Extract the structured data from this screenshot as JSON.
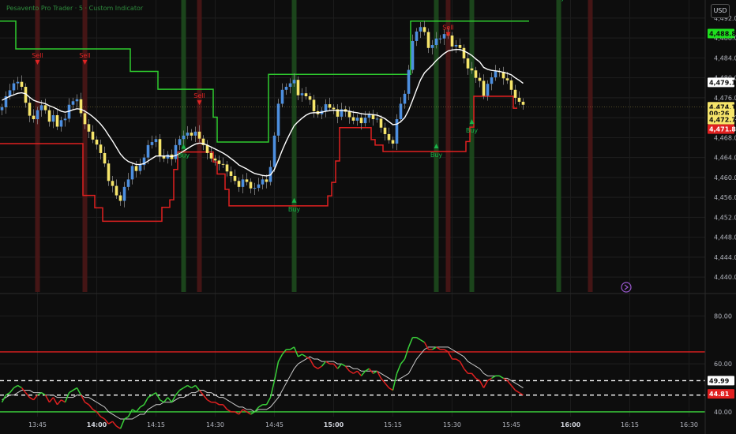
{
  "header": {
    "title": "Pesavento Pro Trader · 5 · Custom Indicator",
    "currency": "USD"
  },
  "colors": {
    "background": "#0d0d0d",
    "bull_candle": "#4d8fe0",
    "bear_candle": "#f6e56a",
    "upper_band": "#2ecc2e",
    "lower_band": "#e02020",
    "basis": "#ffffff",
    "buy_signal": "#19b34a",
    "sell_signal": "#e02424",
    "buy_highlight": "#1d4a1d",
    "sell_highlight": "#4a1616",
    "osc_bull": "#3ad13a",
    "osc_bear": "#e02020",
    "osc_signal": "#cccccc"
  },
  "chart_data": [
    {
      "type": "candlestick",
      "ylim": [
        4437,
        4495
      ],
      "y_ticks": [
        "4,492.00",
        "4,488.00",
        "4,484.00",
        "4,480.00",
        "4,476.00",
        "4,472.00",
        "4,468.00",
        "4,464.00",
        "4,460.00",
        "4,456.00",
        "4,452.00",
        "4,448.00",
        "4,444.00",
        "4,440.00"
      ],
      "y_tick_values": [
        4492,
        4488,
        4484,
        4480,
        4476,
        4472,
        4468,
        4464,
        4460,
        4456,
        4452,
        4448,
        4444,
        4440
      ],
      "x_ticks": [
        "13:45",
        "14:00",
        "14:15",
        "14:30",
        "14:45",
        "15:00",
        "15:15",
        "15:30",
        "15:45",
        "16:00",
        "16:15",
        "16:30"
      ],
      "x_ticks_bold": [
        "14:00",
        "15:00",
        "16:00"
      ],
      "start_time": "13:36",
      "bar_minutes": 1,
      "close": [
        4474.1,
        4476.3,
        4477.5,
        4478.9,
        4479.2,
        4478.2,
        4475.0,
        4472.4,
        4471.7,
        4473.5,
        4474.5,
        4473.5,
        4471.2,
        4472.5,
        4470.2,
        4471.5,
        4471.8,
        4474.6,
        4475.3,
        4475.7,
        4472.9,
        4470.7,
        4469.2,
        4467.6,
        4466.6,
        4464.9,
        4462.8,
        4459.3,
        4458.3,
        4456.4,
        4455.3,
        4458.1,
        4459.6,
        4462.3,
        4461.3,
        4462.5,
        4464.0,
        4466.5,
        4467.1,
        4467.7,
        4464.4,
        4463.8,
        4464.6,
        4463.7,
        4466.5,
        4467.7,
        4468.4,
        4469.0,
        4468.4,
        4469.2,
        4467.8,
        4466.5,
        4464.9,
        4463.8,
        4463.4,
        4462.7,
        4462.6,
        4461.2,
        4460.3,
        4459.3,
        4458.1,
        4459.6,
        4459.1,
        4457.8,
        4457.9,
        4458.6,
        4459.6,
        4459.1,
        4462.1,
        4468.4,
        4474.8,
        4477.6,
        4478.2,
        4478.9,
        4479.6,
        4476.5,
        4476.9,
        4476.3,
        4475.6,
        4473.3,
        4472.7,
        4473.4,
        4474.7,
        4474.0,
        4473.7,
        4472.2,
        4473.7,
        4473.2,
        4472.1,
        4471.4,
        4472.0,
        4470.9,
        4472.0,
        4472.6,
        4471.7,
        4471.8,
        4470.0,
        4468.7,
        4467.5,
        4466.8,
        4471.7,
        4474.8,
        4476.8,
        4481.6,
        4487.4,
        4489.3,
        4490.2,
        4489.2,
        4486.0,
        4486.6,
        4487.9,
        4487.9,
        4488.8,
        4488.5,
        4486.3,
        4486.6,
        4486.0,
        4483.9,
        4481.9,
        4481.5,
        4480.0,
        4479.4,
        4476.4,
        4478.8,
        4480.1,
        4481.3,
        4481.2,
        4479.9,
        4479.5,
        4477.6,
        4476.0,
        4475.2,
        4474.6
      ],
      "series": [
        {
          "name": "Upper band",
          "values": [
            4491.4,
            4491.4,
            4491.4,
            4491.4,
            4485.8,
            4485.8,
            4485.8,
            4485.8,
            4485.8,
            4485.8,
            4485.8,
            4485.8,
            4485.8,
            4485.8,
            4485.8,
            4485.8,
            4485.8,
            4485.8,
            4485.8,
            4485.8,
            4485.8,
            4485.8,
            4485.8,
            4485.8,
            4485.8,
            4485.8,
            4485.8,
            4485.8,
            4485.8,
            4485.8,
            4485.8,
            4485.8,
            4485.8,
            4481.3,
            4481.3,
            4481.3,
            4481.3,
            4481.3,
            4481.3,
            4481.3,
            4477.7,
            4477.7,
            4477.7,
            4477.7,
            4477.7,
            4477.7,
            4477.7,
            4477.7,
            4477.7,
            4477.7,
            4477.7,
            4477.7,
            4477.7,
            4477.7,
            4472.1,
            4467.1,
            4467.1,
            4467.1,
            4467.1,
            4467.1,
            4467.1,
            4467.1,
            4467.1,
            4467.1,
            4467.1,
            4467.1,
            4467.1,
            4467.1,
            4480.7,
            4480.7,
            4480.7,
            4480.7,
            4480.7,
            4480.7,
            4480.7,
            4480.7,
            4480.7,
            4480.7,
            4480.7,
            4480.7,
            4480.7,
            4480.7,
            4480.7,
            4480.7,
            4480.7,
            4480.7,
            4480.7,
            4480.7,
            4480.7,
            4480.7,
            4480.7,
            4480.7,
            4480.7,
            4480.7,
            4480.7,
            4480.7,
            4480.7,
            4480.7,
            4480.7,
            4480.7,
            4480.7,
            4480.7,
            4480.7,
            4480.7,
            4491.4,
            4491.4,
            4491.4,
            4491.4,
            4491.4,
            4491.4,
            4491.4,
            4491.4,
            4491.4,
            4491.4,
            4491.4,
            4491.4,
            4491.4,
            4491.4,
            4491.4,
            4491.4,
            4491.4,
            4491.4,
            4491.4,
            4491.4,
            4491.4,
            4491.4,
            4491.4,
            4491.4,
            4491.4,
            4491.4,
            4491.4,
            4491.4,
            4491.4,
            4491.4
          ]
        },
        {
          "name": "Lower band",
          "values": [
            4466.8,
            4466.8,
            4466.8,
            4466.8,
            4466.8,
            4466.8,
            4466.8,
            4466.8,
            4466.8,
            4466.8,
            4466.8,
            4466.8,
            4466.8,
            4466.8,
            4466.8,
            4466.8,
            4466.8,
            4466.8,
            4466.8,
            4466.8,
            4466.8,
            4456.4,
            4456.4,
            4456.4,
            4453.9,
            4453.9,
            4451.2,
            4451.2,
            4451.2,
            4451.2,
            4451.2,
            4451.2,
            4451.2,
            4451.2,
            4451.2,
            4451.2,
            4451.2,
            4451.2,
            4451.2,
            4451.2,
            4451.2,
            4454.0,
            4454.0,
            4455.5,
            4461.6,
            4465.1,
            4465.1,
            4465.1,
            4465.1,
            4465.1,
            4465.1,
            4465.1,
            4465.1,
            4465.1,
            4463.1,
            4460.7,
            4460.7,
            4457.6,
            4454.3,
            4454.3,
            4454.3,
            4454.3,
            4454.3,
            4454.3,
            4454.3,
            4454.3,
            4454.3,
            4454.3,
            4454.3,
            4454.3,
            4454.3,
            4454.3,
            4454.3,
            4454.3,
            4454.3,
            4454.3,
            4454.3,
            4454.3,
            4454.3,
            4454.3,
            4454.3,
            4454.3,
            4454.3,
            4456.3,
            4459.0,
            4463.3,
            4470.0,
            4470.0,
            4470.0,
            4470.0,
            4470.0,
            4470.0,
            4470.0,
            4470.0,
            4467.6,
            4466.5,
            4466.5,
            4465.2,
            4465.2,
            4465.2,
            4465.2,
            4465.2,
            4465.2,
            4465.2,
            4465.2,
            4465.2,
            4465.2,
            4465.2,
            4465.2,
            4465.2,
            4465.2,
            4465.2,
            4465.2,
            4465.2,
            4465.2,
            4465.2,
            4465.2,
            4465.2,
            4467.2,
            4470.1,
            4476.3,
            4476.3,
            4476.3,
            4476.3,
            4476.3,
            4476.3,
            4476.3,
            4476.3,
            4476.3,
            4476.3,
            4473.9
          ]
        },
        {
          "name": "Basis",
          "values": [
            4475.5,
            4475.9,
            4476.3,
            4476.6,
            4476.9,
            4477.0,
            4476.8,
            4476.1,
            4475.5,
            4475.2,
            4475.0,
            4474.8,
            4474.4,
            4474.1,
            4473.7,
            4473.3,
            4473.1,
            4473.3,
            4473.6,
            4473.8,
            4473.7,
            4473.3,
            4472.8,
            4472.2,
            4471.5,
            4470.7,
            4469.7,
            4468.5,
            4467.3,
            4466.0,
            4464.7,
            4463.8,
            4463.2,
            4462.9,
            4462.6,
            4462.6,
            4462.8,
            4463.3,
            4463.8,
            4464.3,
            4464.3,
            4464.3,
            4464.3,
            4464.2,
            4464.4,
            4464.8,
            4465.3,
            4465.8,
            4466.3,
            4466.7,
            4466.9,
            4466.8,
            4466.5,
            4466.1,
            4465.7,
            4465.3,
            4464.9,
            4464.4,
            4463.8,
            4463.2,
            4462.5,
            4462.1,
            4461.7,
            4461.2,
            4460.8,
            4460.6,
            4460.4,
            4460.3,
            4460.5,
            4461.6,
            4463.5,
            4465.5,
            4467.3,
            4468.9,
            4470.4,
            4471.2,
            4471.9,
            4472.5,
            4472.9,
            4473.0,
            4473.0,
            4473.1,
            4473.3,
            4473.4,
            4473.5,
            4473.4,
            4473.4,
            4473.4,
            4473.3,
            4473.1,
            4473.0,
            4472.8,
            4472.7,
            4472.7,
            4472.6,
            4472.5,
            4472.2,
            4471.8,
            4471.2,
            4470.6,
            4470.7,
            4471.2,
            4472.0,
            4473.5,
            4475.5,
            4477.6,
            4479.6,
            4481.0,
            4481.8,
            4482.6,
            4483.5,
            4484.2,
            4484.9,
            4485.4,
            4485.6,
            4485.7,
            4485.7,
            4485.4,
            4485.0,
            4484.5,
            4483.8,
            4483.2,
            4482.1,
            4481.7,
            4481.5,
            4481.4,
            4481.3,
            4481.1,
            4480.9,
            4480.6,
            4480.0,
            4479.5,
            4478.9
          ]
        }
      ],
      "price_labels": [
        {
          "text": "4,488.88",
          "kind": "upper",
          "value": 4488.9
        },
        {
          "text": "4,479.14",
          "kind": "basis",
          "value": 4479.1
        },
        {
          "text": "4,474.19",
          "kind": "last",
          "value": 4474.2
        },
        {
          "text": "00:26",
          "kind": "countdown",
          "value": 4472.9
        },
        {
          "text": "4,472.74",
          "kind": "last",
          "value": 4471.6
        },
        {
          "text": "4,471.83",
          "kind": "lower",
          "value": 4469.7
        }
      ],
      "annotations": [
        {
          "text": "Sell",
          "time": "13:45"
        },
        {
          "text": "Sell",
          "time": "13:57"
        },
        {
          "text": "Buy",
          "time": "14:22"
        },
        {
          "text": "Sell",
          "time": "14:26"
        },
        {
          "text": "Buy",
          "time": "14:50"
        },
        {
          "text": "Buy",
          "time": "15:26"
        },
        {
          "text": "Sell",
          "time": "15:29"
        },
        {
          "text": "Buy",
          "time": "15:35"
        },
        {
          "text": "Buy",
          "time": "15:57"
        },
        {
          "text": "Sell",
          "time": "16:05"
        }
      ]
    },
    {
      "type": "line",
      "ylim": [
        38,
        88
      ],
      "y_ticks": [
        "80.00",
        "60.00",
        "40.00"
      ],
      "y_tick_values": [
        80,
        60,
        40
      ],
      "reference_lines": [
        {
          "value": 65,
          "color": "#e02020",
          "style": "solid"
        },
        {
          "value": 53,
          "color": "#ffffff",
          "style": "dashed"
        },
        {
          "value": 47,
          "color": "#ffffff",
          "style": "dashed"
        },
        {
          "value": 40,
          "color": "#3ad13a",
          "style": "solid"
        }
      ],
      "series": [
        {
          "name": "Oscillator",
          "values": [
            44,
            47,
            48,
            50,
            51,
            50,
            48,
            46,
            45,
            47,
            48,
            47,
            44,
            46,
            43,
            45,
            44,
            48,
            49,
            50,
            47,
            44,
            43,
            41,
            40,
            38,
            37,
            35,
            36,
            34,
            33,
            37,
            38,
            41,
            40,
            42,
            43,
            46,
            47,
            48,
            45,
            44,
            46,
            44,
            47,
            49,
            50,
            51,
            50,
            51,
            49,
            47,
            45,
            44,
            44,
            43,
            43,
            41,
            40,
            40,
            39,
            41,
            40,
            39,
            40,
            42,
            43,
            43,
            46,
            53,
            61,
            64,
            66,
            66,
            67,
            63,
            64,
            63,
            62,
            59,
            58,
            59,
            61,
            60,
            60,
            58,
            60,
            59,
            57,
            56,
            57,
            55,
            57,
            58,
            56,
            57,
            54,
            52,
            50,
            49,
            56,
            60,
            62,
            67,
            71,
            71,
            70,
            69,
            66,
            66,
            67,
            66,
            66,
            65,
            62,
            62,
            61,
            58,
            56,
            56,
            54,
            53,
            50,
            53,
            54,
            55,
            55,
            54,
            53,
            51,
            49,
            48,
            47
          ]
        },
        {
          "name": "Signal",
          "values": [
            45,
            46,
            47,
            47,
            48,
            49,
            49,
            49,
            48,
            48,
            48,
            47,
            47,
            47,
            46,
            46,
            46,
            46,
            46,
            47,
            47,
            46,
            46,
            45,
            44,
            43,
            42,
            40,
            39,
            38,
            37,
            37,
            37,
            37,
            38,
            39,
            39,
            41,
            42,
            43,
            43,
            44,
            44,
            44,
            45,
            46,
            46,
            47,
            48,
            48,
            49,
            49,
            48,
            48,
            47,
            46,
            46,
            45,
            44,
            43,
            42,
            42,
            41,
            41,
            40,
            41,
            41,
            41,
            42,
            44,
            46,
            49,
            52,
            55,
            58,
            60,
            61,
            62,
            63,
            62,
            62,
            61,
            61,
            61,
            61,
            60,
            60,
            59,
            59,
            58,
            58,
            57,
            57,
            57,
            57,
            57,
            56,
            55,
            54,
            53,
            53,
            54,
            55,
            56,
            59,
            62,
            64,
            66,
            67,
            67,
            67,
            67,
            67,
            67,
            66,
            65,
            64,
            63,
            61,
            60,
            59,
            58,
            56,
            55,
            55,
            55,
            55,
            54,
            54,
            53,
            52,
            51,
            50
          ]
        }
      ],
      "value_labels": [
        {
          "text": "49.99",
          "kind": "signal",
          "value": 53
        },
        {
          "text": "44.81",
          "kind": "oscillator",
          "value": 47.5
        }
      ]
    }
  ]
}
